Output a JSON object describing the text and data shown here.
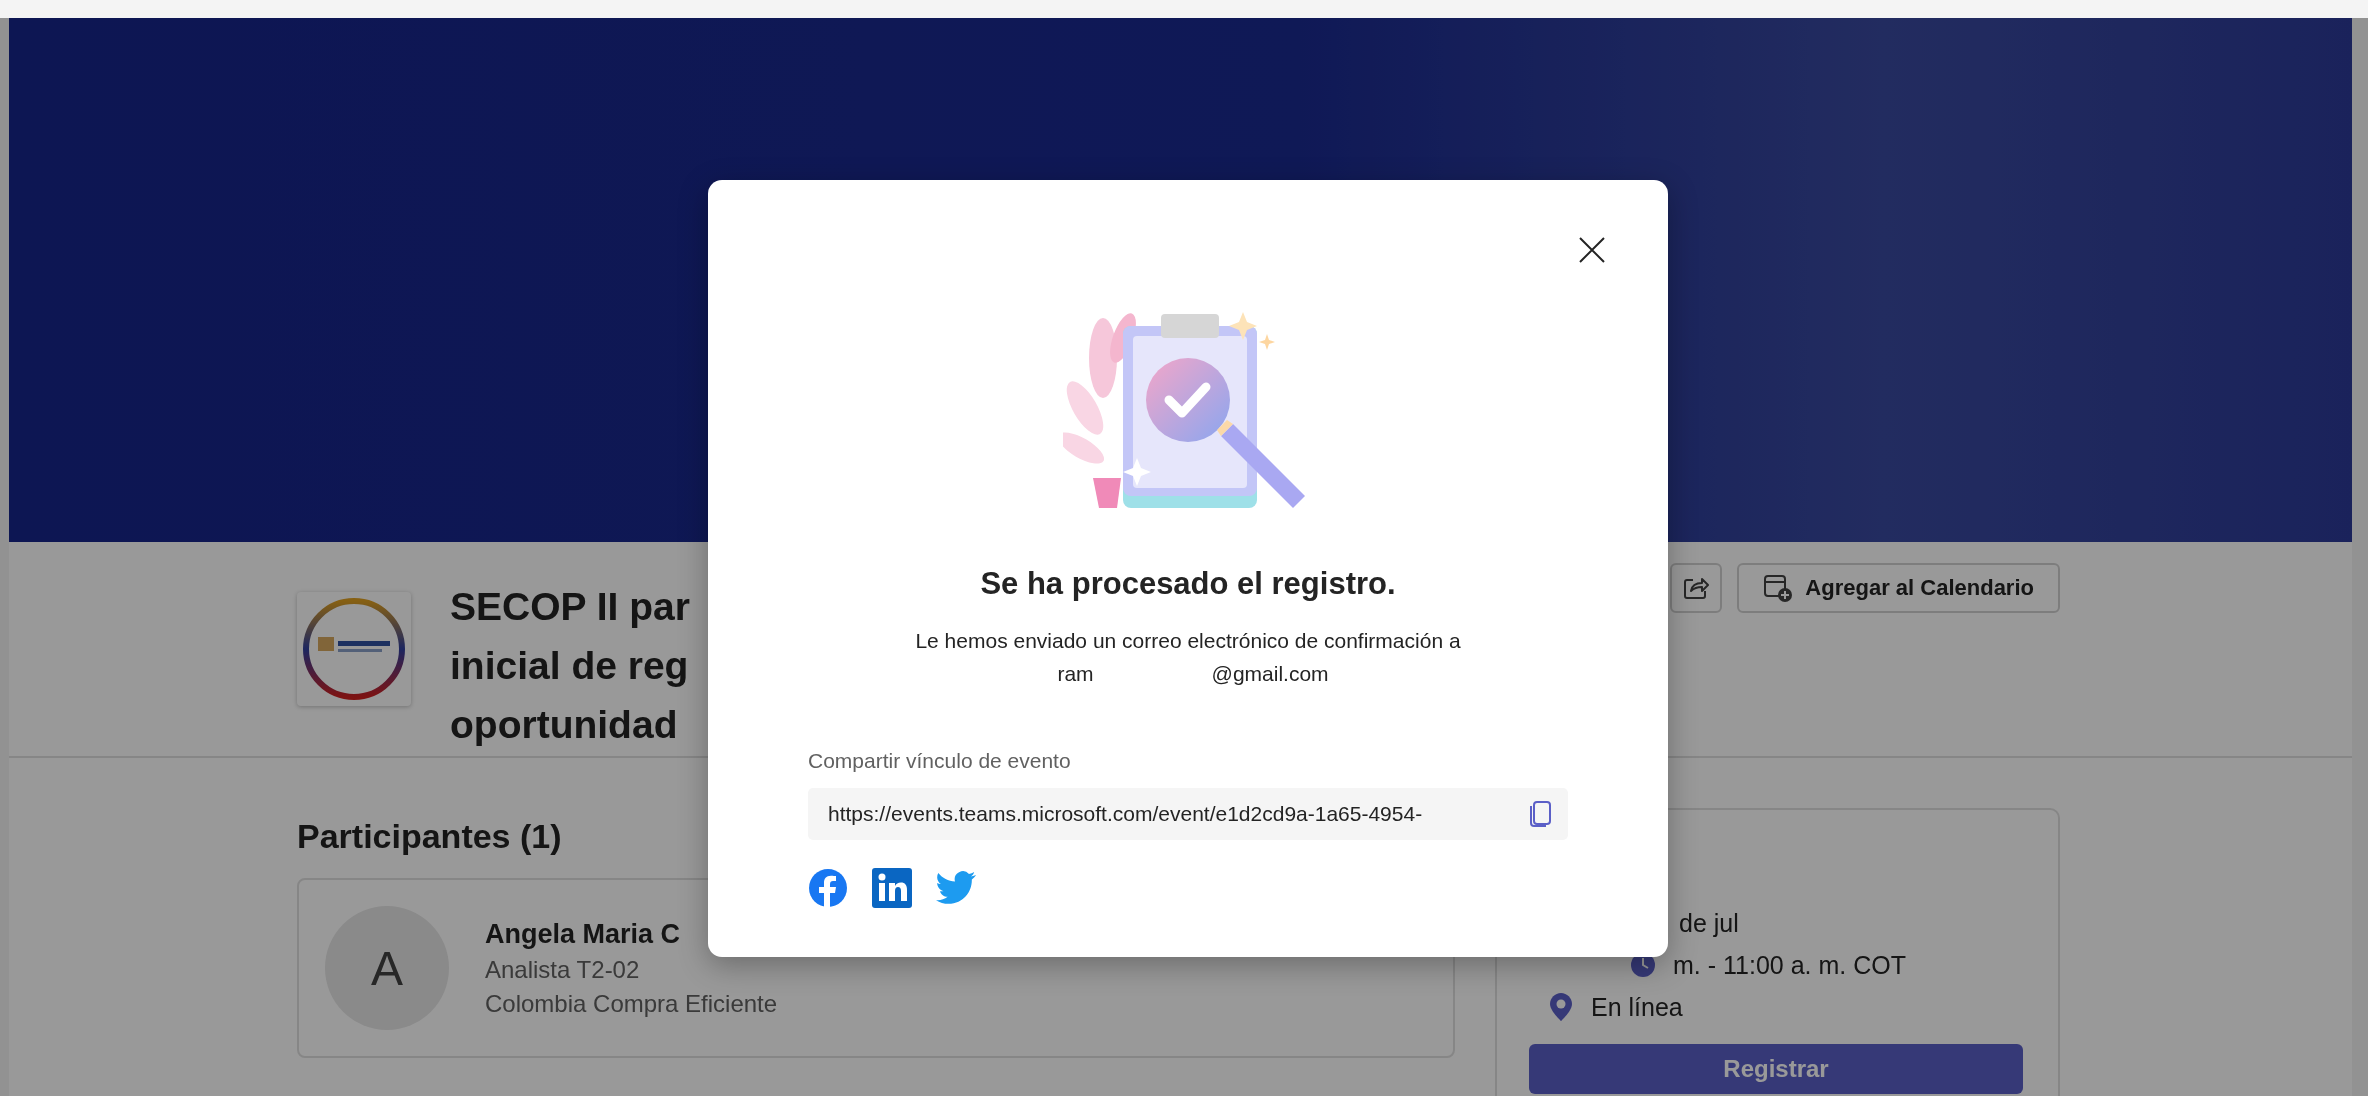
{
  "event": {
    "title_lines": [
      "SECOP II par",
      "inicial de reg",
      "oportunidad"
    ],
    "actions": [
      {
        "kind": "share"
      },
      {
        "kind": "calendar",
        "label": "Agregar al Calendario"
      }
    ]
  },
  "participants": {
    "heading": "Participantes (1)",
    "people": [
      {
        "initial": "A",
        "name": "Angela Maria C",
        "role": "Analista T2-02",
        "org": "Colombia Compra Eficiente"
      }
    ]
  },
  "details": {
    "rows": [
      {
        "kind": "date",
        "text": "de jul"
      },
      {
        "kind": "time",
        "text": "m. - 11:00 a. m. COT"
      },
      {
        "kind": "location",
        "text": "En línea"
      }
    ],
    "button": "Registrar"
  },
  "dialog": {
    "heading": "Se ha procesado el registro.",
    "message": "Le hemos enviado un correo electrónico de confirmación a",
    "email_parts": [
      "ram",
      "@gmail.com"
    ],
    "share_label": "Compartir vínculo de evento",
    "link": "https://events.teams.microsoft.com/event/e1d2cd9a-1a65-4954-",
    "social": [
      {
        "kind": "facebook"
      },
      {
        "kind": "linkedin"
      },
      {
        "kind": "twitter"
      }
    ]
  }
}
